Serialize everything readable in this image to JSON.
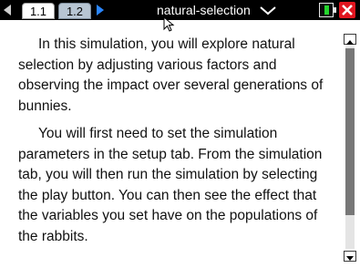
{
  "titlebar": {
    "tabs": [
      {
        "label": "1.1",
        "active": true
      },
      {
        "label": "1.2",
        "active": false
      }
    ],
    "document_title": "natural-selection",
    "colors": {
      "nav_arrow": "#2a86ff",
      "battery": "#25d52d",
      "close": "#e1151f"
    }
  },
  "content": {
    "paragraphs": [
      "In this simulation, you will explore natural selection by adjusting various factors  and observing the impact over several generations of bunnies.",
      "You will first need to set the simulation parameters in the setup tab.  From the simulation tab, you will then run the simulation by selecting the play button.  You can then see the effect that the variables you set have on the populations of the rabbits."
    ]
  },
  "scrollbar": {
    "thumb_fraction": 0.84
  }
}
